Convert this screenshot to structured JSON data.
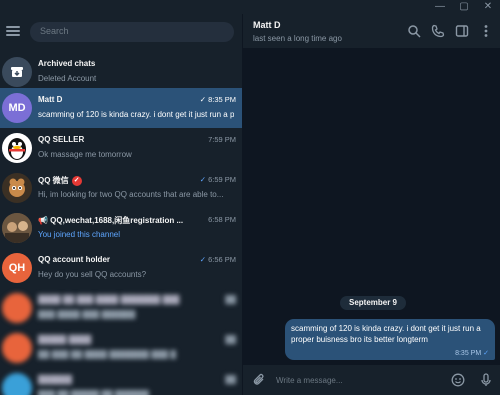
{
  "window": {
    "minimize_label": "—",
    "maximize_label": "▢",
    "close_label": "✕"
  },
  "search": {
    "placeholder": "Search"
  },
  "chats": [
    {
      "name": "Archived chats",
      "preview": "Deleted Account",
      "time": ""
    },
    {
      "name": "Matt D",
      "initials": "MD",
      "preview": "scamming of 120 is kinda crazy. i dont get it just run a proper buisness",
      "time": "8:35 PM",
      "check": "✓"
    },
    {
      "name": "QQ SELLER",
      "preview": "Ok massage me tomorrow",
      "time": "7:59 PM"
    },
    {
      "name": "QQ 微信",
      "preview": "Hi, im looking for two QQ accounts that are able to...",
      "time": "6:59 PM",
      "check": "✓"
    },
    {
      "name": "📢 QQ,wechat,1688,闲鱼registration ...",
      "preview": "You joined this channel",
      "time": "6:58 PM"
    },
    {
      "name": "QQ account holder",
      "initials": "QH",
      "preview": "Hey do you sell QQ accounts?",
      "time": "6:56 PM",
      "check": "✓"
    },
    {
      "name": "████ ██ ███ ████ ███████ ███",
      "preview": "███ ████ ███ ██████",
      "time": "██"
    },
    {
      "name": "█████ ████",
      "preview": "██ ███ ██ ████ ███████ ███ █",
      "time": "██"
    },
    {
      "name": "██████",
      "preview": "███ ██ █████ ██ ██████",
      "time": "██"
    }
  ],
  "header": {
    "title": "Matt D",
    "status": "last seen a long time ago"
  },
  "message": {
    "date": "September 9",
    "text": "scamming of 120 is kinda crazy. i dont get it just run a proper buisness bro its better longterm",
    "time": "8:35 PM",
    "check": "✓"
  },
  "composer": {
    "placeholder": "Write a message..."
  },
  "colors": {
    "sidebar_bg": "#17212b",
    "chat_bg": "#0e1621",
    "active": "#2b5278",
    "accent": "#5ea6ff"
  }
}
